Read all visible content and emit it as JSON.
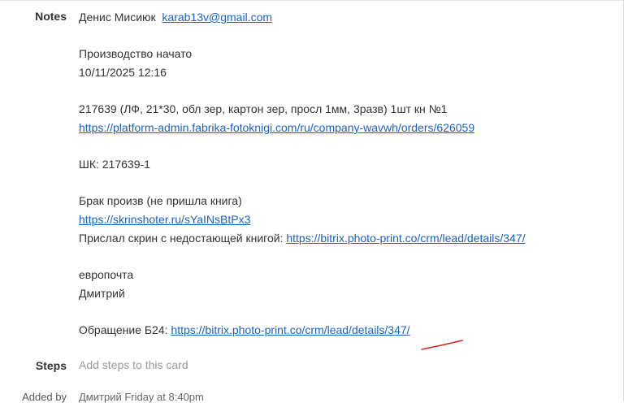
{
  "notes": {
    "label": "Notes",
    "author_name": "Денис Мисиюк",
    "author_email": "karab13v@gmail.com",
    "production_started": "Производство начато",
    "production_date": "10/11/2025 12:16",
    "order_line": "217639 (ЛФ, 21*30, обл зер, картон зер, просл 1мм, 3разв) 1шт кн №1",
    "order_url": "https://platform-admin.fabrika-fotoknigi.com/ru/company-wavwh/orders/626059",
    "barcode": "ШК: 217639-1",
    "defect": "Брак произв (не пришла книга)",
    "screenshot_url": "https://skrinshoter.ru/sYaINsBtPx3",
    "sent_screenshot_prefix": "Прислал скрин с недостающей книгой: ",
    "sent_screenshot_url": "https://bitrix.photo-print.co/crm/lead/details/347/",
    "shipping": "европочта",
    "manager": "Дмитрий",
    "appeal_prefix": "Обращение Б24: ",
    "appeal_url": "https://bitrix.photo-print.co/crm/lead/details/347/"
  },
  "steps": {
    "label": "Steps",
    "placeholder": "Add steps to this card"
  },
  "added_by": {
    "label": "Added by",
    "value": "Дмитрий Friday at 8:40pm"
  },
  "colors": {
    "link": "#1a62c0",
    "annotation": "#e02020"
  }
}
